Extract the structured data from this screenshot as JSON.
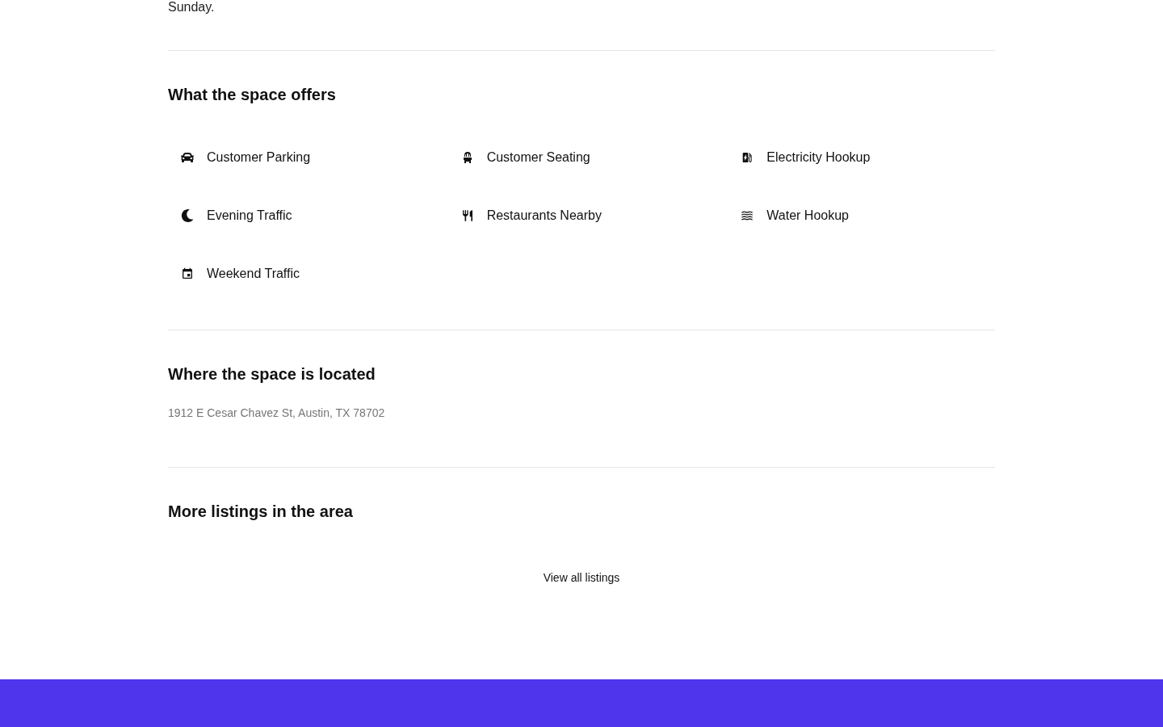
{
  "intro": {
    "text": "Sunday."
  },
  "offers": {
    "title": "What the space offers",
    "amenities": [
      {
        "kind": "parking",
        "label": "Customer Parking"
      },
      {
        "kind": "seating",
        "label": "Customer Seating"
      },
      {
        "kind": "electricity",
        "label": "Electricity Hookup"
      },
      {
        "kind": "evening",
        "label": "Evening Traffic"
      },
      {
        "kind": "restaurants",
        "label": "Restaurants Nearby"
      },
      {
        "kind": "water",
        "label": "Water Hookup"
      },
      {
        "kind": "weekend",
        "label": "Weekend Traffic"
      }
    ]
  },
  "location": {
    "title": "Where the space is located",
    "address": "1912 E Cesar Chavez St, Austin, TX 78702"
  },
  "more_listings": {
    "title": "More listings in the area",
    "link": "View all listings"
  }
}
